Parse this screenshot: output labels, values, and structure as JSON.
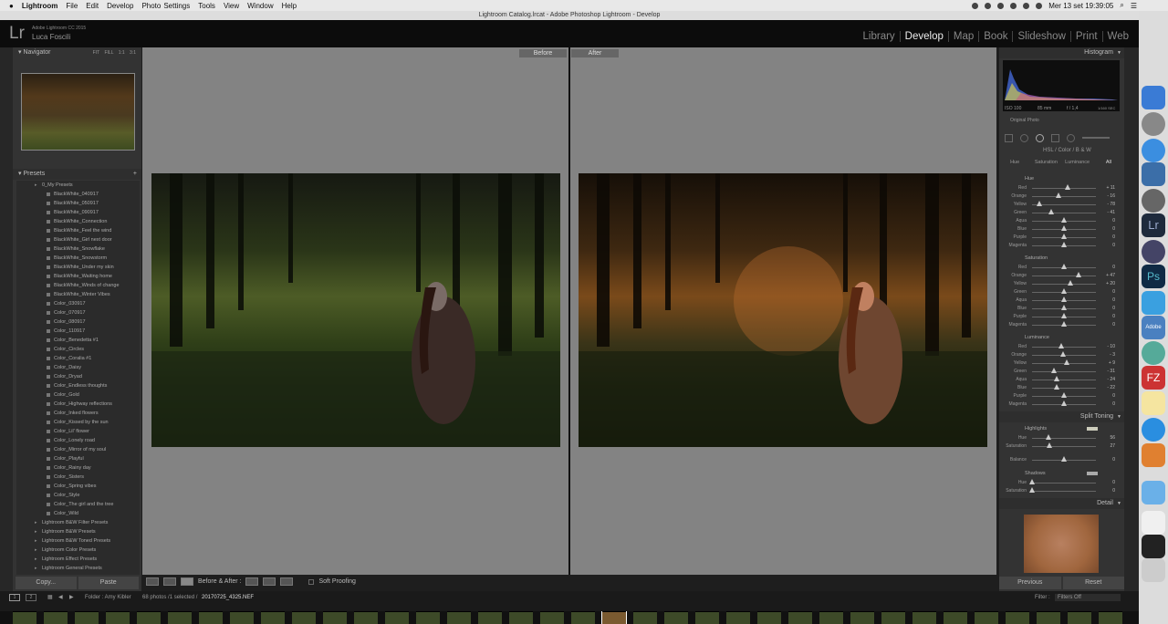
{
  "menubar": {
    "app": "Lightroom",
    "items": [
      "File",
      "Edit",
      "Develop",
      "Photo",
      "Settings",
      "Tools",
      "View",
      "Window",
      "Help"
    ],
    "clock": "Mer 13 set  19:39:05"
  },
  "titlebar": {
    "title": "Lightroom Catalog.lrcat - Adobe Photoshop Lightroom - Develop"
  },
  "identity": {
    "logo": "Lr",
    "product": "Adobe Lightroom CC 2015",
    "user": "Luca Foscili"
  },
  "modules": [
    "Library",
    "Develop",
    "Map",
    "Book",
    "Slideshow",
    "Print",
    "Web"
  ],
  "active_module": "Develop",
  "navigator": {
    "title": "Navigator",
    "zoom_options": [
      "FIT",
      "FILL",
      "1:1",
      "3:1"
    ]
  },
  "presets": {
    "title": "Presets",
    "add": "+",
    "open_folder": "0_My Presets",
    "items": [
      "BlackWhite_040917",
      "BlackWhite_050917",
      "BlackWhite_090917",
      "BlackWhite_Connection",
      "BlackWhite_Feel the wind",
      "BlackWhite_Girl next door",
      "BlackWhite_Snowflake",
      "BlackWhite_Snowstorm",
      "BlackWhite_Under my skin",
      "BlackWhite_Waiting home",
      "BlackWhite_Winds of change",
      "BlackWhite_Winter Vibes",
      "Color_030917",
      "Color_070917",
      "Color_080917",
      "Color_110917",
      "Color_Benedetta #1",
      "Color_Circles",
      "Color_Coralia #1",
      "Color_Daisy",
      "Color_Dryad",
      "Color_Endless thoughts",
      "Color_Gold",
      "Color_Highway reflections",
      "Color_Inked flowers",
      "Color_Kissed by the sun",
      "Color_Lil' flower",
      "Color_Lonely road",
      "Color_Mirror of my soul",
      "Color_Playful",
      "Color_Rainy day",
      "Color_Sisters",
      "Color_Spring vibes",
      "Color_Style",
      "Color_The girl and the tree",
      "Color_Wild"
    ],
    "folders": [
      "Lightroom B&W Filter Presets",
      "Lightroom B&W Presets",
      "Lightroom B&W Toned Presets",
      "Lightroom Color Presets",
      "Lightroom Effect Presets",
      "Lightroom General Presets"
    ]
  },
  "left_buttons": {
    "copy": "Copy...",
    "paste": "Paste"
  },
  "view": {
    "before": "Before",
    "after": "After"
  },
  "toolbar": {
    "label": "Before & After :",
    "soft_proofing": "Soft Proofing"
  },
  "right": {
    "histogram": "Histogram",
    "hist_info": [
      "ISO 100",
      "85 mm",
      "f / 1,4",
      "1/160 SEC"
    ],
    "original_photo": "Original Photo",
    "hsl_header": "HSL  /  Color  /  B & W",
    "hsl_tabs": [
      "Hue",
      "Saturation",
      "Luminance",
      "All"
    ],
    "hue_title": "Hue",
    "sat_title": "Saturation",
    "lum_title": "Luminance",
    "colors": [
      "Red",
      "Orange",
      "Yellow",
      "Green",
      "Aqua",
      "Blue",
      "Purple",
      "Magenta"
    ],
    "hue": [
      11,
      -16,
      -78,
      -41,
      0,
      0,
      0,
      0
    ],
    "saturation": [
      0,
      47,
      20,
      0,
      0,
      0,
      0,
      0
    ],
    "luminance": [
      -10,
      -3,
      9,
      -31,
      -24,
      -22,
      0,
      0
    ],
    "hue_text": [
      "+ 11",
      "- 16",
      "- 78",
      "- 41",
      "0",
      "0",
      "0",
      "0"
    ],
    "sat_text": [
      "0",
      "+ 47",
      "+ 20",
      "0",
      "0",
      "0",
      "0",
      "0"
    ],
    "lum_text": [
      "- 10",
      "- 3",
      "+ 9",
      "- 31",
      "- 24",
      "- 22",
      "0",
      "0"
    ],
    "split_toning": "Split Toning",
    "highlights": "Highlights",
    "hl_hue_label": "Hue",
    "hl_hue": "56",
    "hl_sat_label": "Saturation",
    "hl_sat": "27",
    "balance_label": "Balance",
    "balance": "0",
    "shadows": "Shadows",
    "sh_hue_label": "Hue",
    "sh_hue": "0",
    "sh_sat_label": "Saturation",
    "sh_sat": "0",
    "detail": "Detail",
    "previous": "Previous",
    "reset": "Reset"
  },
  "filmstrip": {
    "pages": [
      "1",
      "2"
    ],
    "folder": "Folder : Amy Kibler",
    "count": "68 photos /1 selected /",
    "filename": "20170725_4325.NEF",
    "filter_label": "Filter :",
    "filter_value": "Filters Off"
  },
  "colors": {
    "accent": "#ffffff",
    "panel": "#333333",
    "canvas": "#838383"
  }
}
